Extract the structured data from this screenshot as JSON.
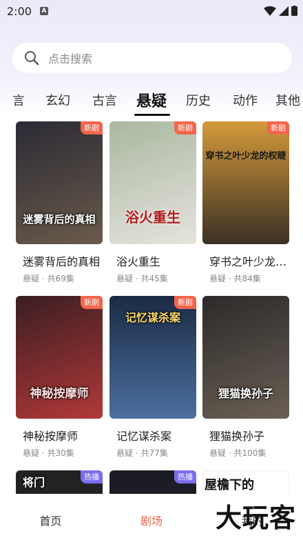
{
  "status": {
    "time": "2:00",
    "notif_glyph": "A"
  },
  "search": {
    "placeholder": "点击搜索",
    "icon": "search-icon"
  },
  "tabs": [
    {
      "label": "言"
    },
    {
      "label": "玄幻"
    },
    {
      "label": "古言"
    },
    {
      "label": "悬疑",
      "active": true
    },
    {
      "label": "历史"
    },
    {
      "label": "动作"
    },
    {
      "label": "其他"
    }
  ],
  "cards": [
    {
      "title": "迷雾背后的真相",
      "meta": "悬疑 · 共69集",
      "badge": "新剧",
      "badge_type": "new",
      "poster_text": "迷雾背后的真相",
      "colors": [
        "#2b2a35",
        "#6a5a4a"
      ]
    },
    {
      "title": "浴火重生",
      "meta": "悬疑 · 共45集",
      "badge": "新剧",
      "badge_type": "new",
      "poster_text": "浴火重生",
      "colors": [
        "#a9b8a0",
        "#e6e3de"
      ]
    },
    {
      "title": "穿书之叶少龙的权睫",
      "meta": "悬疑 · 共84集",
      "badge": "新剧",
      "badge_type": "new",
      "poster_text": "穿书之叶少龙的权睫",
      "colors": [
        "#d39a3a",
        "#3b3024"
      ]
    },
    {
      "title": "神秘按摩师",
      "meta": "悬疑 · 共30集",
      "badge": "新剧",
      "badge_type": "new",
      "poster_text": "神秘按摩师",
      "colors": [
        "#3a1e22",
        "#b23838"
      ]
    },
    {
      "title": "记忆谋杀案",
      "meta": "悬疑 · 共77集",
      "badge": "新剧",
      "badge_type": "new",
      "poster_text": "记忆谋杀案",
      "colors": [
        "#1b2b44",
        "#4b6fa0"
      ]
    },
    {
      "title": "狸猫换孙子",
      "meta": "悬疑 · 共100集",
      "badge": "",
      "badge_type": "",
      "poster_text": "狸猫换孙子",
      "colors": [
        "#2c2a2a",
        "#6a5f54"
      ]
    },
    {
      "title": "",
      "meta": "",
      "badge": "热播",
      "badge_type": "hot",
      "poster_text": "将门",
      "colors": [
        "#222",
        "#444"
      ]
    },
    {
      "title": "",
      "meta": "",
      "badge": "热播",
      "badge_type": "hot",
      "poster_text": "",
      "colors": [
        "#1c1c24",
        "#3a3a48"
      ]
    },
    {
      "title": "",
      "meta": "",
      "badge": "",
      "badge_type": "",
      "poster_text": "屋檐下的",
      "colors": [
        "#ffffff",
        "#ffffff"
      ]
    }
  ],
  "bottom_nav": [
    {
      "label": "首页"
    },
    {
      "label": "剧场",
      "active": true
    },
    {
      "label": "我的"
    }
  ],
  "watermark": "大玩客"
}
